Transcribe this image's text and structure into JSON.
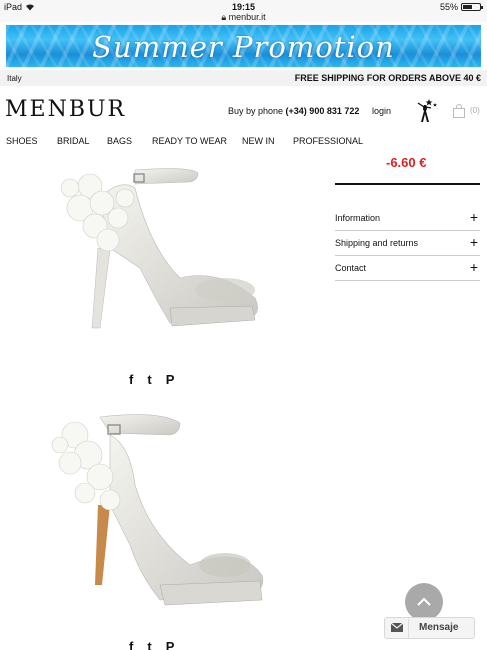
{
  "status_bar": {
    "device": "iPad",
    "time": "19:15",
    "url": "menbur.it",
    "battery": "55%",
    "battery_level": 0.55
  },
  "banner": {
    "text": "Summer  Promotion"
  },
  "info_bar": {
    "country": "Italy",
    "shipping": "FREE SHIPPING FOR ORDERS ABOVE 40 €"
  },
  "header": {
    "logo": "MENBUR",
    "phone_label": "Buy by phone ",
    "phone_number": "(+34) 900 831 722",
    "login": "login",
    "cart_count": "(0)"
  },
  "nav": [
    "SHOES",
    "BRIDAL",
    "BAGS",
    "READY TO WEAR",
    "NEW IN",
    "PROFESSIONAL"
  ],
  "product": {
    "price": "-6.60 €",
    "accordion": [
      "Information",
      "Shipping and returns",
      "Contact"
    ],
    "share": [
      "f",
      "t",
      "P"
    ]
  },
  "chat": {
    "label": "Mensaje"
  },
  "colors": {
    "price": "#e02020",
    "banner": "#1aa3e8"
  }
}
